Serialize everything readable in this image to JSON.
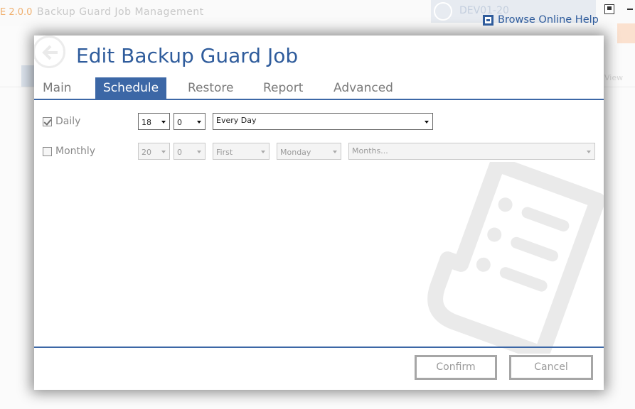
{
  "background": {
    "version": "E 2.0.0",
    "title": "Backup Guard Job Management",
    "server": "DEV01-20",
    "view": "View"
  },
  "help": {
    "label": "Browse Online Help"
  },
  "modal": {
    "title": "Edit Backup Guard Job",
    "tabs": [
      {
        "label": "Main",
        "active": false
      },
      {
        "label": "Schedule",
        "active": true
      },
      {
        "label": "Restore",
        "active": false
      },
      {
        "label": "Report",
        "active": false
      },
      {
        "label": "Advanced",
        "active": false
      }
    ],
    "schedule": {
      "daily": {
        "label": "Daily",
        "checked": true,
        "hour": "18",
        "minute": "0",
        "frequency": "Every Day"
      },
      "monthly": {
        "label": "Monthly",
        "checked": false,
        "hour": "20",
        "minute": "0",
        "ordinal": "First",
        "weekday": "Monday",
        "months": "Months..."
      }
    },
    "buttons": {
      "confirm": "Confirm",
      "cancel": "Cancel"
    }
  },
  "colors": {
    "accent": "#3c67a6",
    "link": "#2f5c9c",
    "muted": "#8a8a8a"
  }
}
